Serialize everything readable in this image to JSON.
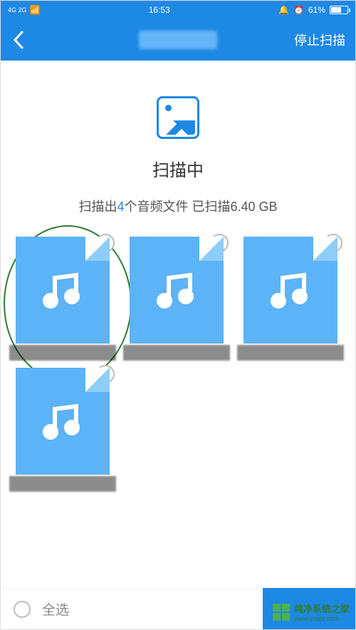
{
  "status": {
    "network": "4G 2G",
    "time": "16:53",
    "battery": "61%"
  },
  "header": {
    "stop": "停止扫描"
  },
  "scan": {
    "title": "扫描中",
    "prefix": "扫描出",
    "count": "4",
    "mid": "个音频文件 已扫描",
    "size": "6.40 GB"
  },
  "footer": {
    "selectAll": "全选"
  },
  "watermark": {
    "text": "纯净系统之家",
    "url": "www.ycwjz.com"
  }
}
